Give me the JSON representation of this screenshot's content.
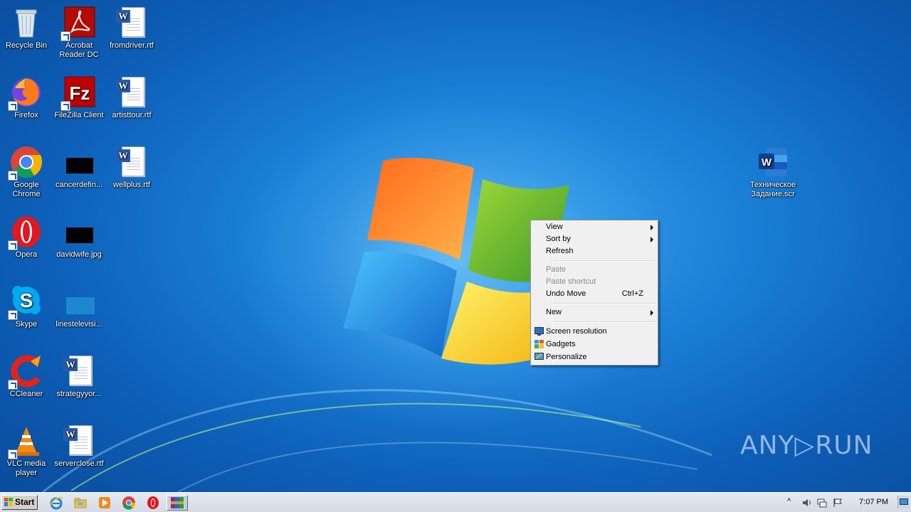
{
  "desktop": {
    "icons": [
      {
        "label": "Recycle Bin"
      },
      {
        "label": "Acrobat Reader DC"
      },
      {
        "label": "fromdriver.rtf"
      },
      {
        "label": "Firefox"
      },
      {
        "label": "FileZilla Client"
      },
      {
        "label": "artisttour.rtf"
      },
      {
        "label": "Google Chrome"
      },
      {
        "label": "cancerdefin..."
      },
      {
        "label": "wellplus.rtf"
      },
      {
        "label": "Opera"
      },
      {
        "label": "davidwife.jpg"
      },
      {
        "label": "Skype"
      },
      {
        "label": "linestelevisi..."
      },
      {
        "label": "CCleaner"
      },
      {
        "label": "strategyyor..."
      },
      {
        "label": "VLC media player"
      },
      {
        "label": "serverclose.rtf"
      },
      {
        "label": "Техническое Задание.scr"
      }
    ]
  },
  "context_menu": {
    "items": [
      {
        "label": "View"
      },
      {
        "label": "Sort by"
      },
      {
        "label": "Refresh"
      },
      {
        "label": "Paste"
      },
      {
        "label": "Paste shortcut"
      },
      {
        "label": "Undo Move",
        "shortcut": "Ctrl+Z"
      },
      {
        "label": "New"
      },
      {
        "label": "Screen resolution"
      },
      {
        "label": "Gadgets"
      },
      {
        "label": "Personalize"
      }
    ]
  },
  "taskbar": {
    "start_label": "Start",
    "clock": "7:07 PM"
  },
  "watermark": "ANY▷RUN"
}
